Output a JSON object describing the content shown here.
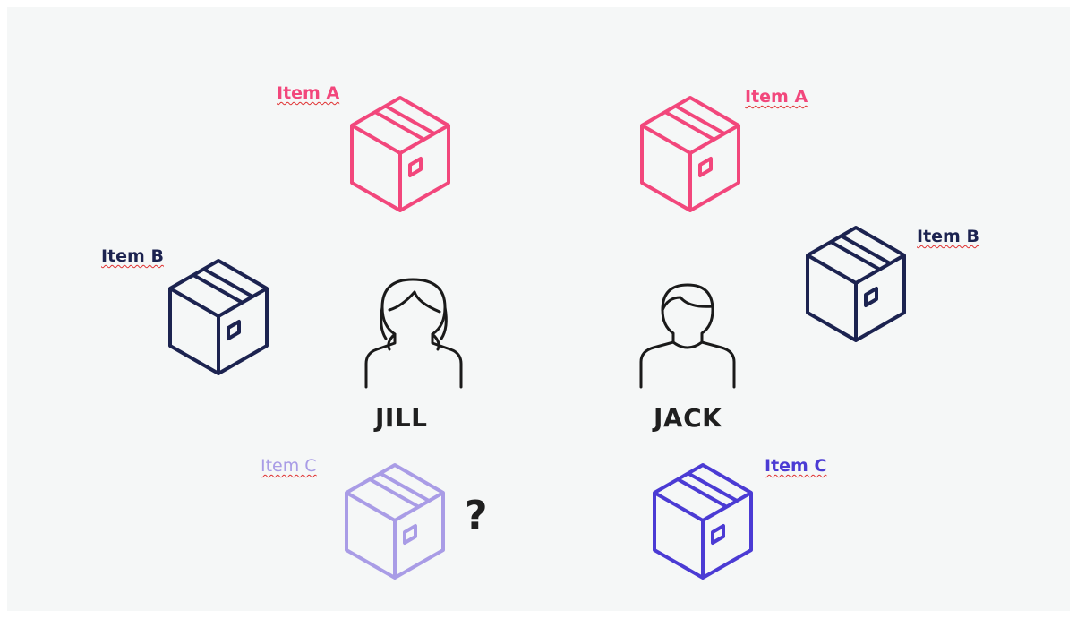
{
  "people": {
    "left": {
      "name": "JILL"
    },
    "right": {
      "name": "JACK"
    }
  },
  "items": {
    "jill_a": {
      "label": "Item A",
      "color": "#f2477c"
    },
    "jill_b": {
      "label": "Item B",
      "color": "#1c2350"
    },
    "jill_c": {
      "label": "Item C",
      "color": "#a99ce6"
    },
    "jack_a": {
      "label": "Item A",
      "color": "#f2477c"
    },
    "jack_b": {
      "label": "Item B",
      "color": "#1c2350"
    },
    "jack_c": {
      "label": "Item C",
      "color": "#4b3bd4"
    }
  },
  "missing_mark": "?",
  "icons": [
    "box-icon",
    "woman-icon",
    "man-icon"
  ]
}
